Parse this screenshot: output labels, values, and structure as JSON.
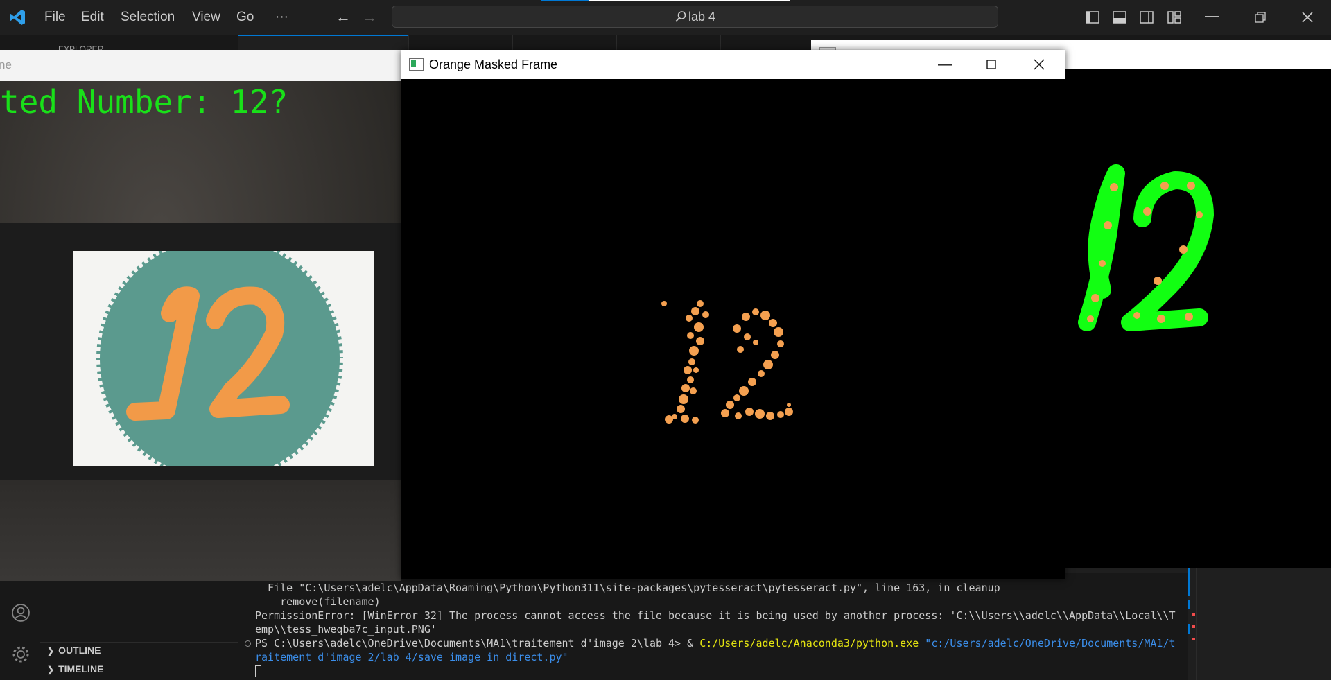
{
  "titlebar": {
    "menu": [
      "File",
      "Edit",
      "Selection",
      "View",
      "Go",
      "···"
    ],
    "search": "lab 4",
    "icons": [
      "vscode-logo-icon",
      "back-arrow-icon",
      "forward-arrow-icon",
      "toggle-primary-sidebar-icon",
      "toggle-panel-icon",
      "toggle-secondary-sidebar-icon",
      "customize-layout-icon"
    ],
    "window_controls": [
      "minimize-icon",
      "restore-icon",
      "close-icon"
    ]
  },
  "sidebar": {
    "header": "EXPLORER",
    "sections": [
      "OUTLINE",
      "TIMELINE"
    ]
  },
  "camera_window": {
    "title": "ne",
    "overlay_text": "ted Number: 12?"
  },
  "orange_window": {
    "title": "Orange Masked Frame",
    "digits": "12"
  },
  "green_window": {
    "digits": "12"
  },
  "terminal": {
    "lines": [
      "  File \"C:\\Users\\adelc\\AppData\\Roaming\\Python\\Python311\\site-packages\\pytesseract\\pytesseract.py\", line 163, in cleanup",
      "    remove(filename)",
      "PermissionError: [WinError 32] The process cannot access the file because it is being used by another process: 'C:\\\\Users\\\\adelc\\\\AppData\\\\Local\\\\T",
      "emp\\\\tess_hweqba7c_input.PNG'"
    ],
    "prompt": "PS C:\\Users\\adelc\\OneDrive\\Documents\\MA1\\traitement d'image 2\\lab 4> & ",
    "exe": "C:/Users/adelc/Anaconda3/python.exe",
    "script_1": "\"c:/Users/adelc/OneDrive/Documents/MA1/t",
    "script_2": "raitement d'image 2/lab 4/save_image_in_direct.py\""
  },
  "colors": {
    "accent": "#0078d4",
    "overlay_green": "#19e019",
    "orange_mask": "#f4a050",
    "contour_green": "#12ff12",
    "exe_yellow": "#e5e510",
    "path_blue": "#3b8eea"
  }
}
